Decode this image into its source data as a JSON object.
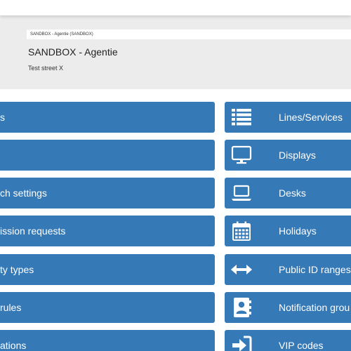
{
  "header": {
    "breadcrumb": "SANDBOX - Agentie (SANDBOX)",
    "title": "SANDBOX - Agentie",
    "address": "Test street X"
  },
  "left_tiles": [
    {
      "label": "s"
    },
    {
      "label": ""
    },
    {
      "label": "ch settings"
    },
    {
      "label": "ission requests"
    },
    {
      "label": "ty types"
    },
    {
      "label": "rules"
    },
    {
      "label": "ations"
    }
  ],
  "right_tiles": [
    {
      "label": "Lines/Services",
      "icon": "list-icon"
    },
    {
      "label": "Displays",
      "icon": "monitor-icon"
    },
    {
      "label": "Desks",
      "icon": "laptop-icon"
    },
    {
      "label": "Holidays",
      "icon": "calendar-icon"
    },
    {
      "label": "Public ID ranges",
      "icon": "left-right-arrow-icon"
    },
    {
      "label": "Notification grou",
      "icon": "address-book-icon"
    },
    {
      "label": "VIP codes",
      "icon": "sign-in-icon"
    }
  ],
  "colors": {
    "tile_blue": "#3679b7",
    "header_gray": "#ececec"
  }
}
